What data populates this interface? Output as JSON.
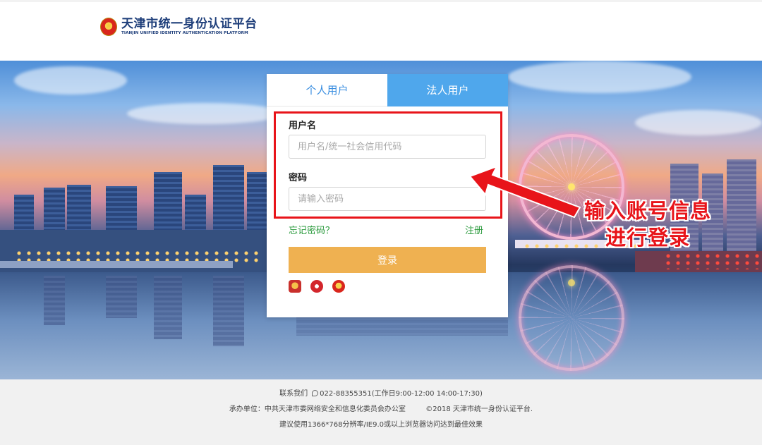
{
  "header": {
    "title_cn": "天津市统一身份认证平台",
    "title_en": "TIANJIN UNIFIED IDENTITY AUTHENTICATION PLATFORM",
    "emblem_icon": "national-emblem-icon"
  },
  "login": {
    "tabs": [
      {
        "label": "个人用户",
        "active": false
      },
      {
        "label": "法人用户",
        "active": true
      }
    ],
    "username": {
      "label": "用户名",
      "placeholder": "用户名/统一社会信用代码",
      "value": ""
    },
    "password": {
      "label": "密码",
      "placeholder": "请输入密码",
      "value": ""
    },
    "forgot_label": "忘记密码？",
    "register_label": "注册",
    "login_button_label": "登录",
    "other_login_icons": [
      "police-badge-icon",
      "seal-icon",
      "emblem-icon"
    ]
  },
  "annotation": {
    "line1": "输入账号信息",
    "line2": "进行登录",
    "color": "#e8141a"
  },
  "footer": {
    "contact_label": "联系我们",
    "phone": "022-88355351(工作日9:00-12:00 14:00-17:30)",
    "organizer": "承办单位：中共天津市委网络安全和信息化委员会办公室",
    "copyright": "©2018 天津市统一身份认证平台.",
    "browser_tip": "建议使用1366*768分辨率/IE9.0或以上浏览器访问达到最佳效果"
  },
  "colors": {
    "tab_active": "#4fa7ec",
    "tab_inactive_text": "#3a8ee0",
    "login_button": "#efb151",
    "link_green": "#2a9a3c",
    "brand_blue": "#1e3e7a"
  }
}
